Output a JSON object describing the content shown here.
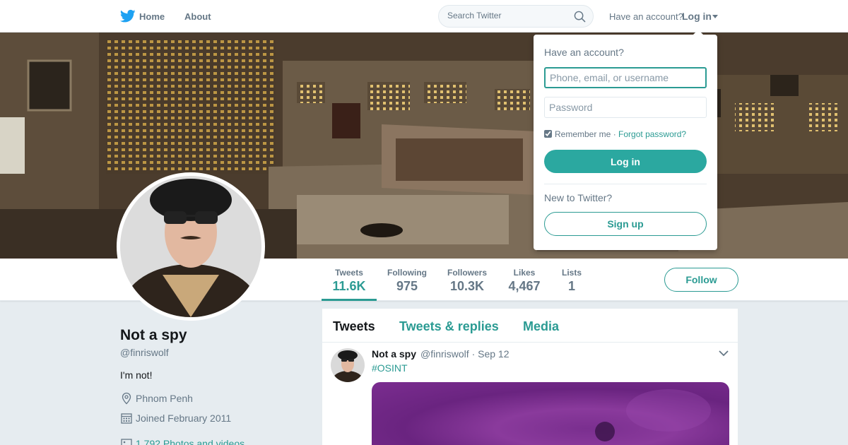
{
  "nav": {
    "logo_icon": "twitter-bird-icon",
    "home_label": "Home",
    "about_label": "About",
    "search_placeholder": "Search Twitter",
    "have_account": "Have an account?",
    "login_label": "Log in",
    "brand_color": "#1da1f2"
  },
  "login_dropdown": {
    "title": "Have an account?",
    "username_placeholder": "Phone, email, or username",
    "password_placeholder": "Password",
    "remember_label": "Remember me",
    "separator": "·",
    "forgot_label": "Forgot password?",
    "login_button": "Log in",
    "new_prompt": "New to Twitter?",
    "signup_button": "Sign up",
    "remember_checked": true
  },
  "stats": [
    {
      "label": "Tweets",
      "value": "11.6K",
      "active": true
    },
    {
      "label": "Following",
      "value": "975"
    },
    {
      "label": "Followers",
      "value": "10.3K"
    },
    {
      "label": "Likes",
      "value": "4,467"
    },
    {
      "label": "Lists",
      "value": "1"
    }
  ],
  "follow_button": "Follow",
  "profile": {
    "name": "Not a spy",
    "handle": "@finriswolf",
    "bio": "I'm not!",
    "location": "Phnom Penh",
    "joined": "Joined February 2011",
    "photos": "1,792 Photos and videos"
  },
  "timeline": {
    "tabs": [
      "Tweets",
      "Tweets & replies",
      "Media"
    ],
    "active_tab": "Tweets",
    "tweet": {
      "name": "Not a spy",
      "handle": "@finriswolf",
      "dot": "·",
      "date": "Sep 12",
      "text": "#OSINT"
    }
  },
  "colors": {
    "accent": "#2b9b93",
    "text_secondary": "#657786"
  }
}
